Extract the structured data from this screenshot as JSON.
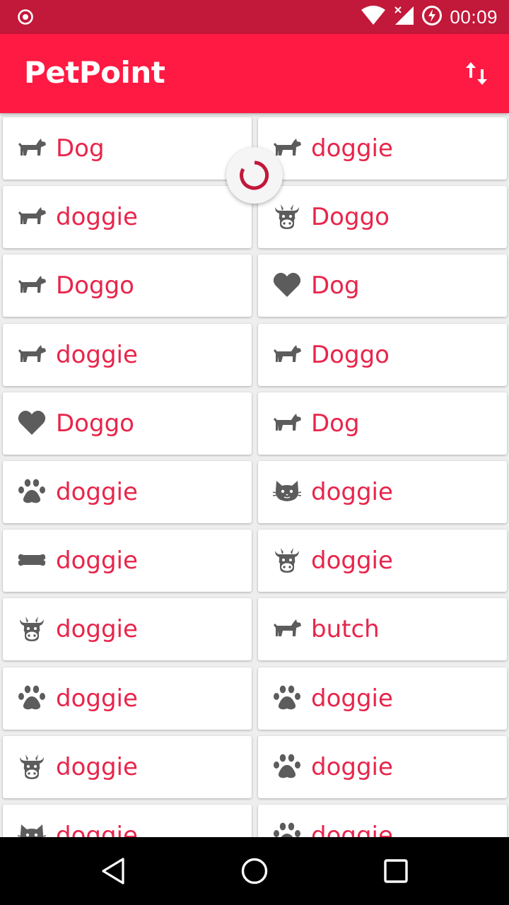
{
  "status_bar": {
    "time": "00:09",
    "icons": [
      "record-icon",
      "wifi-icon",
      "no-signal-icon",
      "battery-charging-icon"
    ]
  },
  "app_bar": {
    "title": "PetPoint",
    "action_icon": "sort-icon"
  },
  "theme": {
    "primary": "#FF1A43",
    "primary_dark": "#C2183A",
    "text_accent": "#E8254B",
    "icon_gray": "#5C5C5C"
  },
  "pets": [
    {
      "icon": "dog-icon",
      "name": "Dog"
    },
    {
      "icon": "dog-icon",
      "name": "doggie"
    },
    {
      "icon": "dog-icon",
      "name": "doggie"
    },
    {
      "icon": "cow-icon",
      "name": "Doggo"
    },
    {
      "icon": "dog-icon",
      "name": "Doggo"
    },
    {
      "icon": "heart-icon",
      "name": "Dog"
    },
    {
      "icon": "dog-icon",
      "name": "doggie"
    },
    {
      "icon": "dog-icon",
      "name": "Doggo"
    },
    {
      "icon": "heart-icon",
      "name": "Doggo"
    },
    {
      "icon": "dog-icon",
      "name": "Dog"
    },
    {
      "icon": "paw-icon",
      "name": "doggie"
    },
    {
      "icon": "cat-icon",
      "name": "doggie"
    },
    {
      "icon": "bone-icon",
      "name": "doggie"
    },
    {
      "icon": "cow-icon",
      "name": "doggie"
    },
    {
      "icon": "cow-icon",
      "name": "doggie"
    },
    {
      "icon": "dog-icon",
      "name": "butch"
    },
    {
      "icon": "paw-icon",
      "name": "doggie"
    },
    {
      "icon": "paw-icon",
      "name": "doggie"
    },
    {
      "icon": "cow-icon",
      "name": "doggie"
    },
    {
      "icon": "paw-icon",
      "name": "doggie"
    },
    {
      "icon": "cat-icon",
      "name": "doggie"
    },
    {
      "icon": "paw-icon",
      "name": "doggie"
    }
  ],
  "loading_indicator": {
    "icon": "spinner-icon"
  },
  "nav_bar": {
    "icons": [
      "back-icon",
      "home-icon",
      "recents-icon"
    ]
  }
}
